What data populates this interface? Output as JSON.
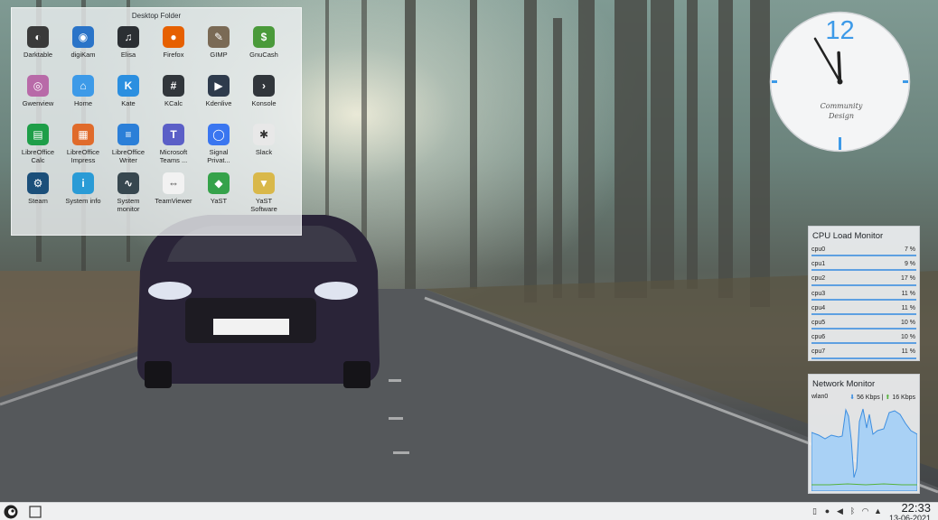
{
  "desktop_folder": {
    "title": "Desktop Folder",
    "apps": [
      {
        "label": "Darktable",
        "icon": "darktable-icon",
        "color": "#3a3a3a",
        "glyph": "◐"
      },
      {
        "label": "digiKam",
        "icon": "digikam-icon",
        "color": "#2a74c8",
        "glyph": "◉"
      },
      {
        "label": "Elisa",
        "icon": "elisa-icon",
        "color": "#2b2f33",
        "glyph": "♫"
      },
      {
        "label": "Firefox",
        "icon": "firefox-icon",
        "color": "#e66000",
        "glyph": "●"
      },
      {
        "label": "GIMP",
        "icon": "gimp-icon",
        "color": "#7a6a55",
        "glyph": "✎"
      },
      {
        "label": "GnuCash",
        "icon": "gnucash-icon",
        "color": "#4a9a3a",
        "glyph": "$"
      },
      {
        "label": "Gwenview",
        "icon": "gwenview-icon",
        "color": "#b86aa8",
        "glyph": "◎"
      },
      {
        "label": "Home",
        "icon": "home-folder-icon",
        "color": "#3d9ae8",
        "glyph": "⌂"
      },
      {
        "label": "Kate",
        "icon": "kate-icon",
        "color": "#2b8fe0",
        "glyph": "K"
      },
      {
        "label": "KCalc",
        "icon": "kcalc-icon",
        "color": "#31363b",
        "glyph": "#"
      },
      {
        "label": "Kdenlive",
        "icon": "kdenlive-icon",
        "color": "#2e3b4c",
        "glyph": "▶"
      },
      {
        "label": "Konsole",
        "icon": "konsole-icon",
        "color": "#31363b",
        "glyph": "›"
      },
      {
        "label": "LibreOffice\nCalc",
        "icon": "libreoffice-calc-icon",
        "color": "#1e9e48",
        "glyph": "▤"
      },
      {
        "label": "LibreOffice\nImpress",
        "icon": "libreoffice-impress-icon",
        "color": "#e06b2b",
        "glyph": "▦"
      },
      {
        "label": "LibreOffice\nWriter",
        "icon": "libreoffice-writer-icon",
        "color": "#2b7fd8",
        "glyph": "≡"
      },
      {
        "label": "Microsoft\nTeams ...",
        "icon": "teams-icon",
        "color": "#5b5fc7",
        "glyph": "T"
      },
      {
        "label": "Signal\nPrivat...",
        "icon": "signal-icon",
        "color": "#3a76f0",
        "glyph": "◯"
      },
      {
        "label": "Slack",
        "icon": "slack-icon",
        "color": "#e8e8e8",
        "glyph": "✱"
      },
      {
        "label": "Steam",
        "icon": "steam-icon",
        "color": "#1b4f7a",
        "glyph": "⚙"
      },
      {
        "label": "System info",
        "icon": "system-info-icon",
        "color": "#2a9bd6",
        "glyph": "i"
      },
      {
        "label": "System\nmonitor",
        "icon": "system-monitor-icon",
        "color": "#37474f",
        "glyph": "∿"
      },
      {
        "label": "TeamViewer",
        "icon": "teamviewer-icon",
        "color": "#f2f2f2",
        "glyph": "⇔"
      },
      {
        "label": "YaST",
        "icon": "yast-icon",
        "color": "#35a24a",
        "glyph": "◆"
      },
      {
        "label": "YaST\nSoftware",
        "icon": "yast-software-icon",
        "color": "#d9b84a",
        "glyph": "▼"
      }
    ]
  },
  "clock_widget": {
    "numeral": "12",
    "brand_line1": "Community",
    "brand_line2": "Design",
    "hour": 11,
    "minute": 55
  },
  "cpu_monitor": {
    "title": "CPU Load Monitor",
    "cores": [
      {
        "name": "cpu0",
        "value": "7 %"
      },
      {
        "name": "cpu1",
        "value": "9 %"
      },
      {
        "name": "cpu2",
        "value": "17 %"
      },
      {
        "name": "cpu3",
        "value": "11 %"
      },
      {
        "name": "cpu4",
        "value": "11 %"
      },
      {
        "name": "cpu5",
        "value": "10 %"
      },
      {
        "name": "cpu6",
        "value": "10 %"
      },
      {
        "name": "cpu7",
        "value": "11 %"
      }
    ]
  },
  "network_monitor": {
    "title": "Network Monitor",
    "interface": "wlan0",
    "download": "56 Kbps",
    "upload": "16 Kbps"
  },
  "taskbar": {
    "time": "22:33",
    "date": "13-06-2021"
  },
  "colors": {
    "accent": "#3d8ee0",
    "upload": "#55b23b"
  }
}
